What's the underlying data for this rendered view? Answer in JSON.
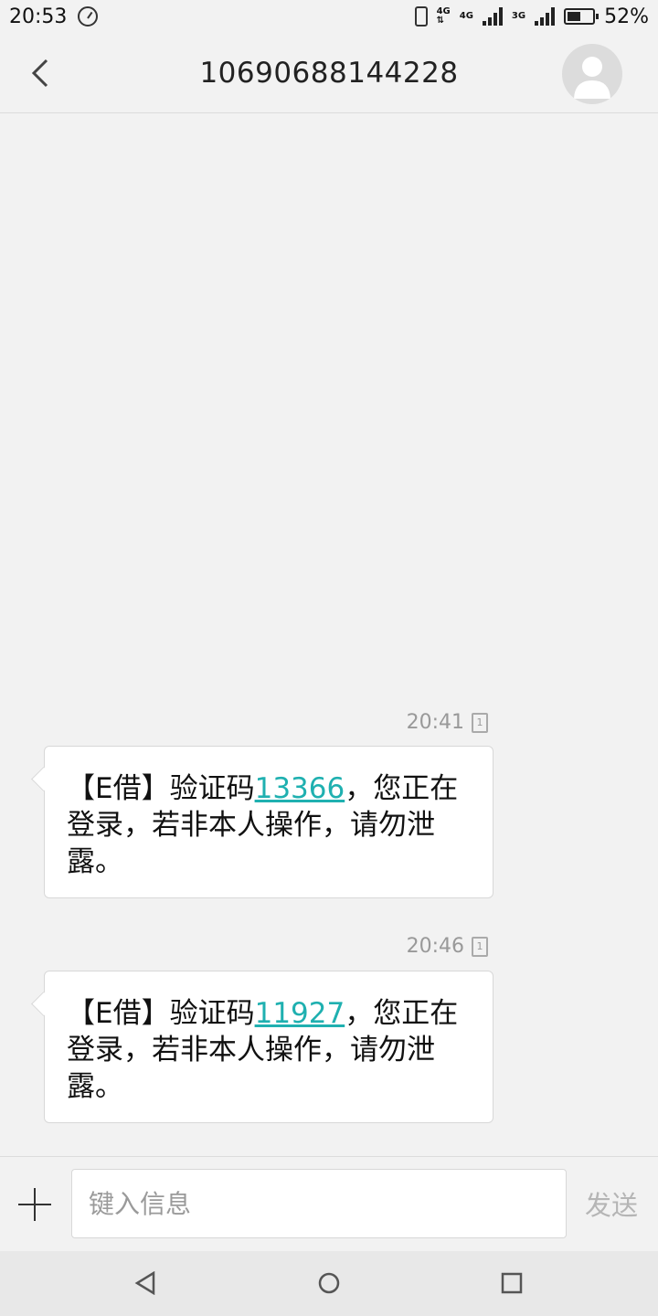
{
  "status_bar": {
    "time": "20:53",
    "battery": "52%",
    "battery_level": 0.52,
    "net1": "4G",
    "net2": "4G",
    "net3": "3G"
  },
  "header": {
    "title": "10690688144228"
  },
  "messages": [
    {
      "time": "20:41",
      "sim": "1",
      "prefix": "【E借】验证码",
      "code": "13366",
      "suffix": "，您正在登录，若非本人操作，请勿泄露。"
    },
    {
      "time": "20:46",
      "sim": "1",
      "prefix": "【E借】验证码",
      "code": "11927",
      "suffix": "，您正在登录，若非本人操作，请勿泄露。"
    }
  ],
  "composer": {
    "placeholder": "键入信息",
    "value": "",
    "send_label": "发送"
  },
  "colors": {
    "code_link": "#1fb0b0",
    "background": "#f2f2f2"
  }
}
